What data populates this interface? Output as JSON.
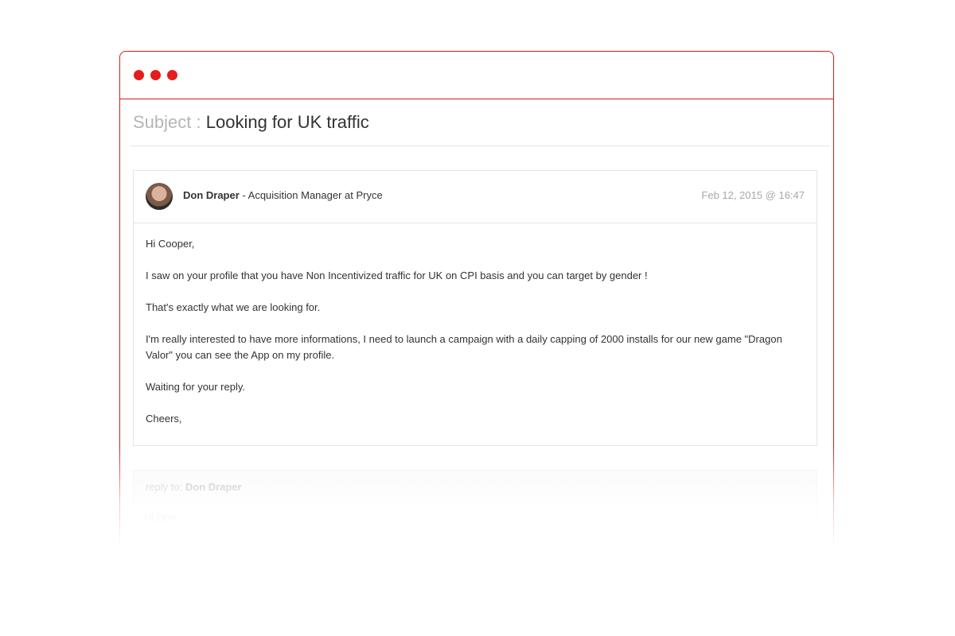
{
  "window": {
    "controls": [
      "close-dot",
      "minimize-dot",
      "maximize-dot"
    ]
  },
  "subject": {
    "label": "Subject :",
    "text": "Looking for UK traffic"
  },
  "message": {
    "sender_name": "Don Draper",
    "sender_role": "- Acquisition Manager at Pryce",
    "timestamp": "Feb 12, 2015 @ 16:47",
    "body": [
      "Hi Cooper,",
      "I saw on your profile that you have Non Incentivized traffic for UK on CPI basis and you can target by gender !",
      "That's exactly what we are looking for.",
      "I'm really interested to have more informations, I need to launch a campaign with a daily capping of 2000 installs for our new game \"Dragon Valor\" you can see the App on my profile.",
      "Waiting for your reply.",
      "Cheers,"
    ]
  },
  "reply": {
    "label": "reply to:",
    "recipient": "Don Draper",
    "draft": "Hi Don,"
  },
  "colors": {
    "accent": "#e51c1c",
    "border": "#d81a1a",
    "muted_text": "#a8a8a8"
  }
}
